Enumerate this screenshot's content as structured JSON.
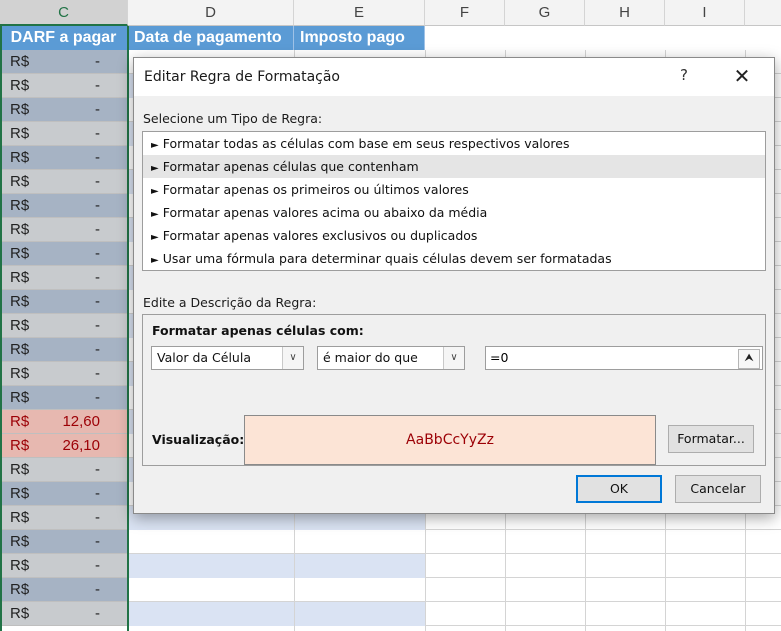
{
  "sheet": {
    "column_headers": [
      "C",
      "D",
      "E",
      "F",
      "G",
      "H",
      "I"
    ],
    "header_row": [
      "DARF a pagar",
      "Data de pagamento",
      "Imposto pago"
    ],
    "rows": [
      {
        "currency": "R$",
        "value": "-"
      },
      {
        "currency": "R$",
        "value": "-"
      },
      {
        "currency": "R$",
        "value": "-"
      },
      {
        "currency": "R$",
        "value": "-"
      },
      {
        "currency": "R$",
        "value": "-"
      },
      {
        "currency": "R$",
        "value": "-"
      },
      {
        "currency": "R$",
        "value": "-"
      },
      {
        "currency": "R$",
        "value": "-"
      },
      {
        "currency": "R$",
        "value": "-"
      },
      {
        "currency": "R$",
        "value": "-"
      },
      {
        "currency": "R$",
        "value": "-"
      },
      {
        "currency": "R$",
        "value": "-"
      },
      {
        "currency": "R$",
        "value": "-"
      },
      {
        "currency": "R$",
        "value": "-"
      },
      {
        "currency": "R$",
        "value": "-"
      },
      {
        "currency": "R$",
        "value": "12,60",
        "highlight": true
      },
      {
        "currency": "R$",
        "value": "26,10",
        "highlight": true
      },
      {
        "currency": "R$",
        "value": "-"
      },
      {
        "currency": "R$",
        "value": "-"
      },
      {
        "currency": "R$",
        "value": "-"
      },
      {
        "currency": "R$",
        "value": "-"
      },
      {
        "currency": "R$",
        "value": "-"
      },
      {
        "currency": "R$",
        "value": "-"
      },
      {
        "currency": "R$",
        "value": "-"
      }
    ],
    "colors": {
      "header_fill": "#5b9bd5",
      "highlight_text": "#9c0006",
      "highlight_fill": "#e7b8b0",
      "selection": "#217346"
    }
  },
  "dialog": {
    "title": "Editar Regra de Formatação",
    "help_label": "?",
    "close_label": "✕",
    "rule_type_label": "Selecione um Tipo de Regra:",
    "rule_types": [
      "Formatar todas as células com base em seus respectivos valores",
      "Formatar apenas células que contenham",
      "Formatar apenas os primeiros ou últimos valores",
      "Formatar apenas valores acima ou abaixo da média",
      "Formatar apenas valores exclusivos ou duplicados",
      "Usar uma fórmula para determinar quais células devem ser formatadas"
    ],
    "selected_rule_index": 1,
    "description_label": "Edite a Descrição da Regra:",
    "description_title": "Formatar apenas células com:",
    "condition_type": "Valor da Célula",
    "operator": "é maior do que",
    "value": "=0",
    "preview_label": "Visualização:",
    "preview_text": "AaBbCcYyZz",
    "format_button": "Formatar...",
    "ok_button": "OK",
    "cancel_button": "Cancelar"
  }
}
